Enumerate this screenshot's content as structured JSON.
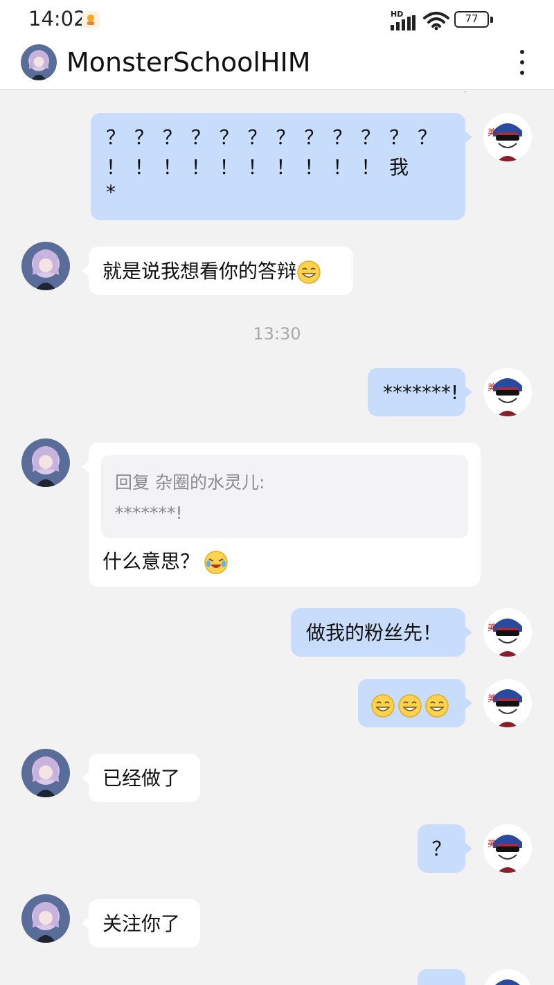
{
  "status_bar": {
    "time": "14:02",
    "network_badge": "HD",
    "battery": "77"
  },
  "header": {
    "title": "MonsterSchoolHIM"
  },
  "messages": [
    {
      "lines": [
        "？ ？ ？ ？ ？ ？ ？ ？ ？ ？ ？ ？",
        "！ ！ ！ ！ ！ ！ ！ ！ ！ ！ 我",
        "*"
      ]
    },
    {
      "text": "就是说我想看你的答辩"
    },
    {
      "text": "*******!"
    },
    {
      "quote_title": "回复 杂圈的水灵儿:",
      "quote_text": "*******!",
      "text": "什么意思？"
    },
    {
      "text": "做我的粉丝先！"
    },
    {
      "text": "已经做了"
    },
    {
      "text": "？"
    },
    {
      "text": "关注你了"
    }
  ],
  "timestamp": "13:30",
  "colors": {
    "sent_bubble": "#c8ddfb",
    "received_bubble": "#ffffff",
    "background": "#f2f2f3"
  }
}
